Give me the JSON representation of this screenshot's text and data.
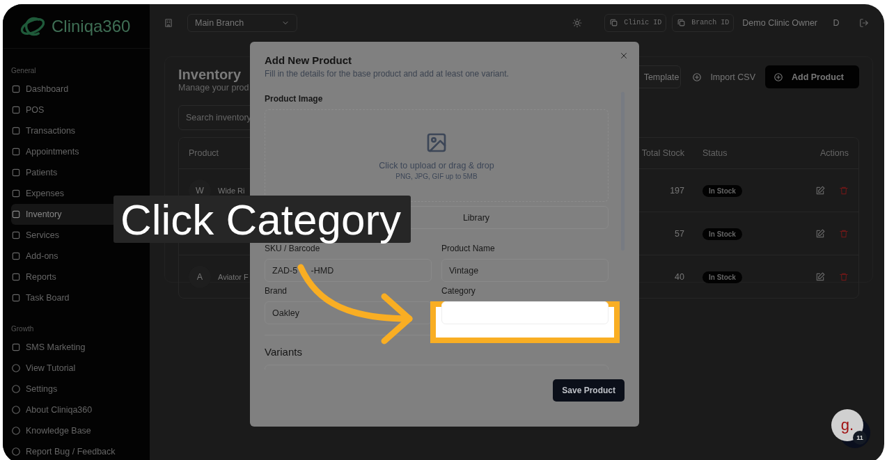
{
  "sidebar": {
    "logo": "Cliniqa360",
    "sections": [
      {
        "heading": "General",
        "items": [
          {
            "label": "Dashboard",
            "selected": false
          },
          {
            "label": "POS",
            "selected": false
          },
          {
            "label": "Transactions",
            "selected": false
          },
          {
            "label": "Appointments",
            "selected": false
          },
          {
            "label": "Patients",
            "selected": false
          },
          {
            "label": "Expenses",
            "selected": false
          },
          {
            "label": "Inventory",
            "selected": true
          },
          {
            "label": "Services",
            "selected": false
          },
          {
            "label": "Add-ons",
            "selected": false
          },
          {
            "label": "Reports",
            "selected": false
          },
          {
            "label": "Task Board",
            "selected": false
          }
        ]
      },
      {
        "heading": "Growth",
        "items": [
          {
            "label": "SMS Marketing",
            "selected": false
          }
        ]
      }
    ],
    "footer_items": [
      "View Tutorial",
      "Settings",
      "About Cliniqa360",
      "Knowledge Base",
      "Report Bug / Feedback"
    ]
  },
  "topbar": {
    "branch": "Main Branch",
    "clinic_id": "Clinic ID",
    "branch_id": "Branch ID",
    "user": "Demo Clinic Owner",
    "avatar": "D"
  },
  "page": {
    "title": "Inventory",
    "subtitle": "Manage your prod",
    "buttons": [
      {
        "label": "Template",
        "kind": "outline"
      },
      {
        "label": "Import CSV",
        "kind": "ghost"
      },
      {
        "label": "Add Product",
        "kind": "primary"
      }
    ],
    "search": {
      "placeholder": "Search inventory"
    },
    "table": {
      "columns": [
        "Product",
        "Total Stock",
        "Status",
        "Actions"
      ],
      "rows": [
        {
          "avatar": "W",
          "product": "Wide Ri",
          "total_stock": "197",
          "status": "In Stock"
        },
        {
          "total_stock": "57",
          "status": "In Stock"
        },
        {
          "avatar": "A",
          "product": "Aviator F",
          "total_stock": "40",
          "status": "In Stock"
        }
      ]
    }
  },
  "modal": {
    "title": "Add New Product",
    "subtitle": "Fill in the details for the base product and add at least one variant.",
    "image_label": "Product Image",
    "upload_text": "Click to upload or drag & drop",
    "upload_hint": "PNG, JPG, GIF up to 5MB",
    "library_button": "Library",
    "fields": [
      {
        "label": "SKU / Barcode",
        "value": "ZAD-5   -HMD"
      },
      {
        "label": "Product Name",
        "value": "Vintage"
      },
      {
        "label": "Brand",
        "value": "Oakley"
      },
      {
        "label": "Category",
        "highlighted": true
      }
    ],
    "section": "Variants",
    "save_button": "Save Product"
  },
  "tutorial": {
    "caption": "Click Category"
  },
  "chat": {
    "logo": "g.",
    "badge": "11"
  }
}
